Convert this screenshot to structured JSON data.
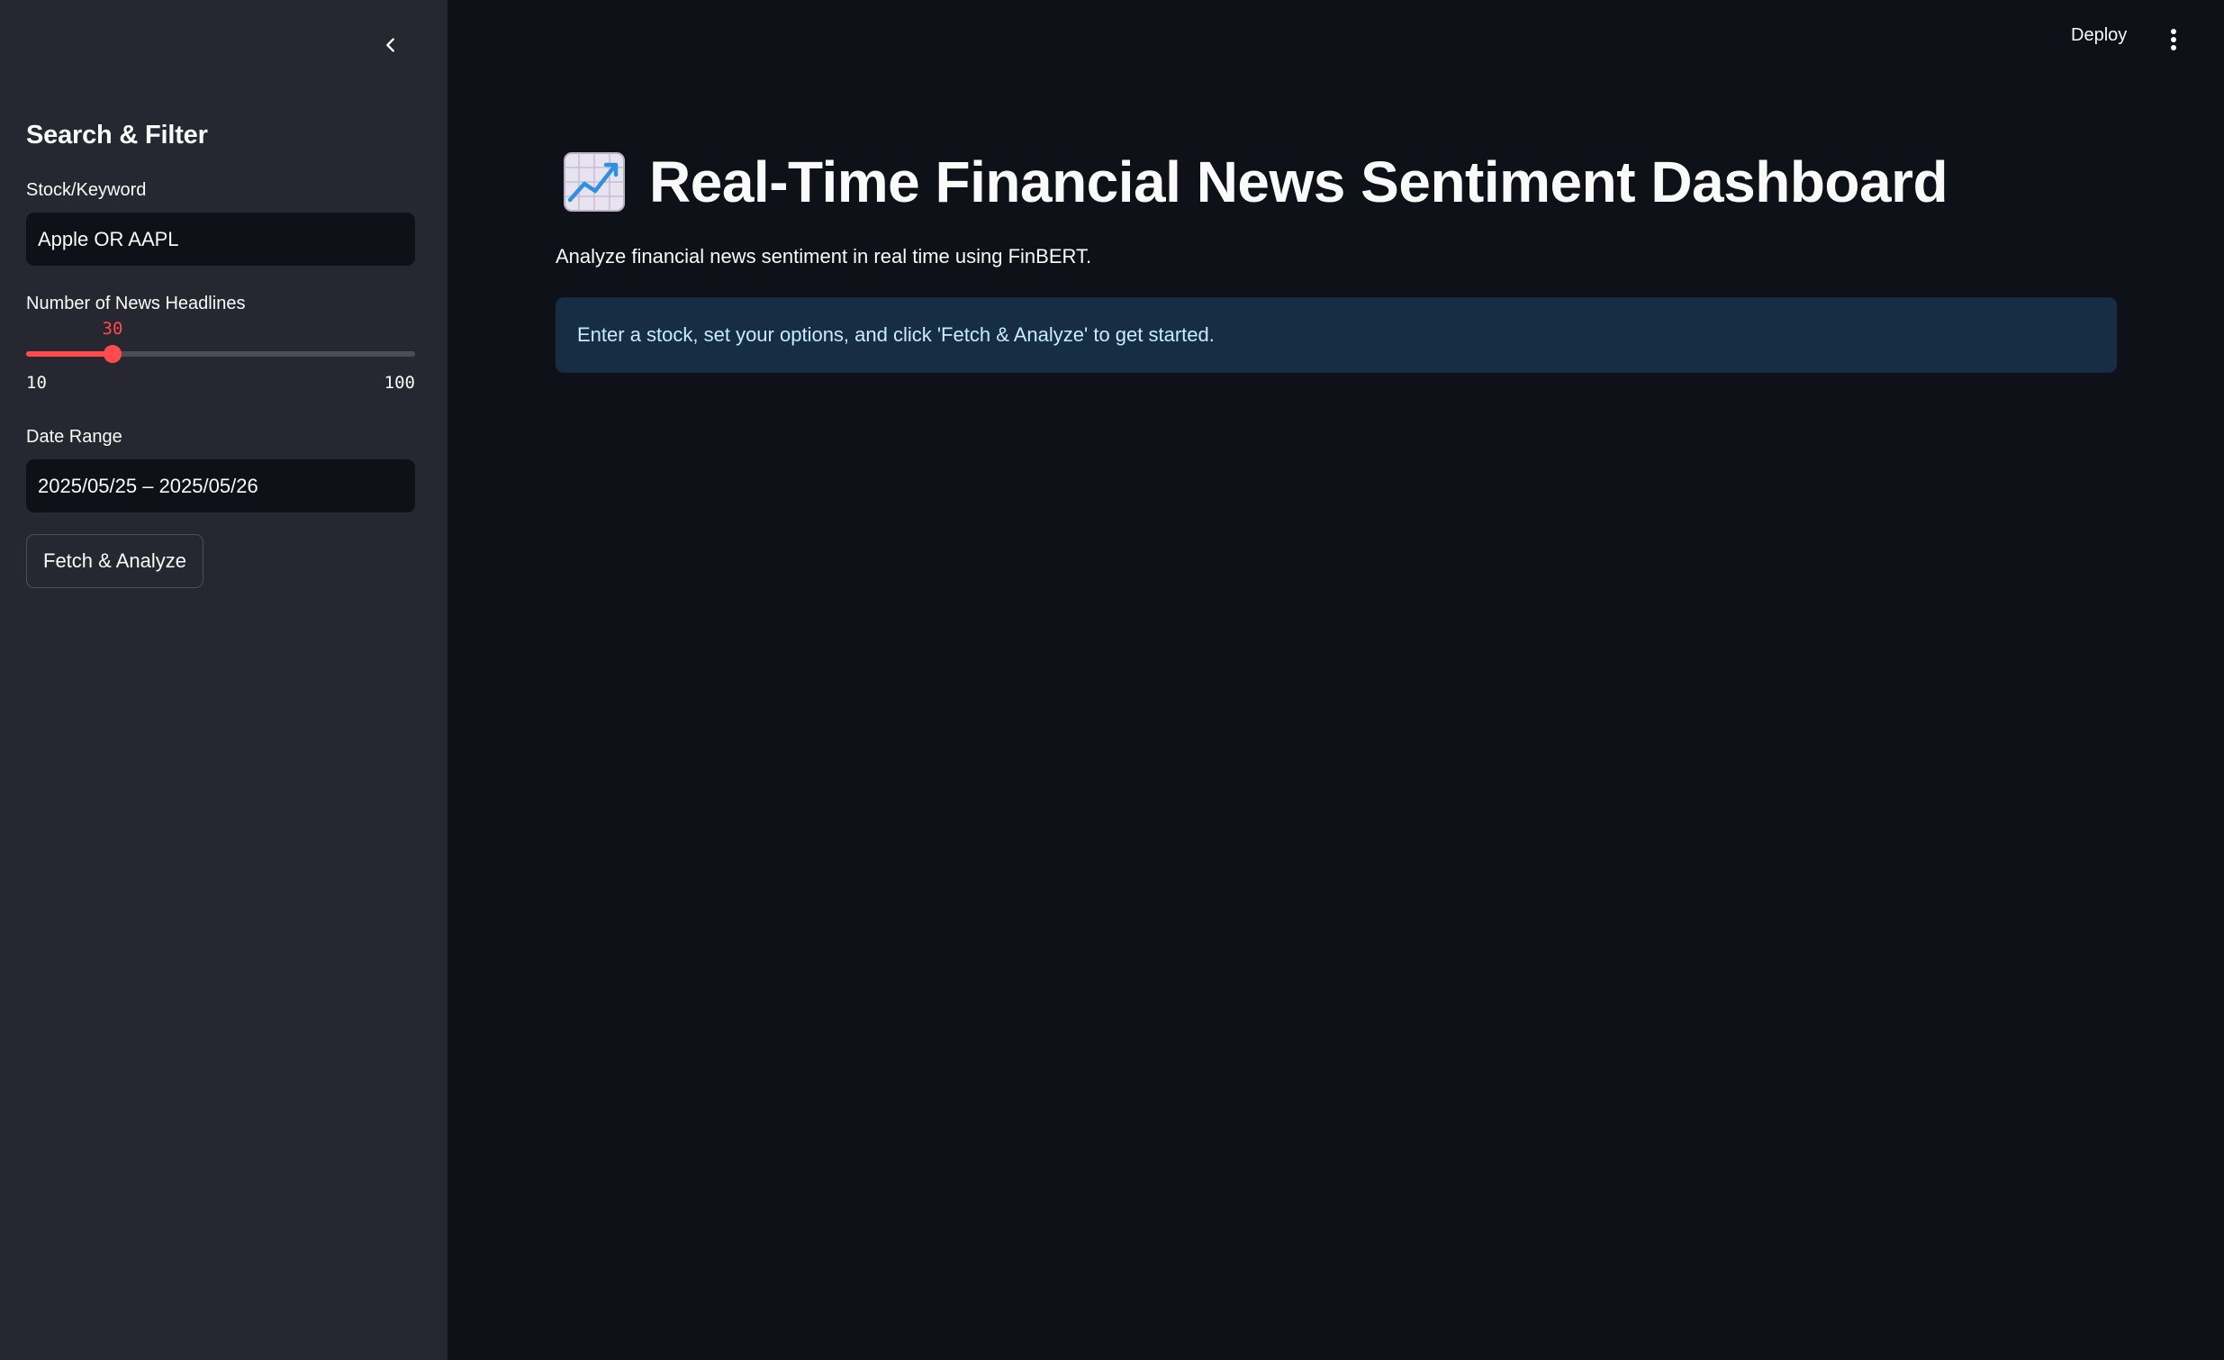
{
  "sidebar": {
    "heading": "Search & Filter",
    "stock_label": "Stock/Keyword",
    "stock_value": "Apple OR AAPL",
    "headlines_label": "Number of News Headlines",
    "slider": {
      "value": "30",
      "min": "10",
      "max": "100",
      "fill_fraction": 0.222
    },
    "date_label": "Date Range",
    "date_value": "2025/05/25 – 2025/05/26",
    "fetch_button": "Fetch & Analyze"
  },
  "header": {
    "deploy_label": "Deploy",
    "more_icon": "vertical-ellipsis-icon"
  },
  "main": {
    "title_icon": "chart-increasing-icon",
    "title": "Real-Time Financial News Sentiment Dashboard",
    "subtitle": "Analyze financial news sentiment in real time using FinBERT.",
    "info_message": "Enter a stock, set your options, and click 'Fetch & Analyze' to get started."
  },
  "colors": {
    "background": "#0e1117",
    "sidebar": "#262730",
    "accent": "#ff4b4b",
    "info_background": "#172d43",
    "info_text": "#c7ebff"
  }
}
